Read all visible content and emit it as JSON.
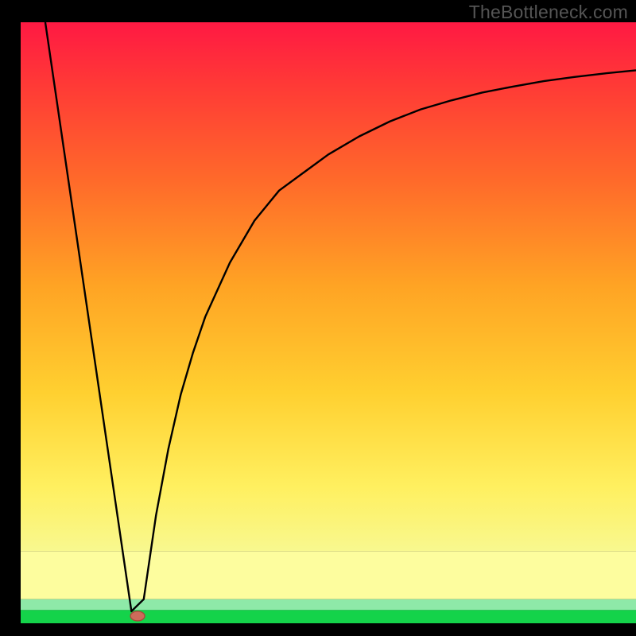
{
  "watermark": "TheBottleneck.com",
  "chart_data": {
    "type": "line",
    "title": "",
    "xlabel": "",
    "ylabel": "",
    "xlim": [
      0,
      100
    ],
    "ylim": [
      0,
      100
    ],
    "curve_description": "V-shaped bottleneck curve: steep linear descent from top-left to a minimum near x≈18, then asymptotic recovery toward top-right.",
    "series": [
      {
        "name": "bottleneck-curve",
        "x": [
          4,
          8,
          12,
          16,
          18,
          20,
          22,
          24,
          26,
          28,
          30,
          34,
          38,
          42,
          46,
          50,
          55,
          60,
          65,
          70,
          75,
          80,
          85,
          90,
          95,
          100
        ],
        "values": [
          100,
          72,
          44,
          16,
          2,
          4,
          18,
          29,
          38,
          45,
          51,
          60,
          67,
          72,
          75,
          78,
          81,
          83.5,
          85.5,
          87,
          88.3,
          89.3,
          90.2,
          90.9,
          91.5,
          92
        ]
      }
    ],
    "marker": {
      "x": 19,
      "y": 1.2
    },
    "bands": [
      {
        "name": "green-strip",
        "y0": 0,
        "y1": 2.2,
        "color": "#14d34a"
      },
      {
        "name": "mint-strip",
        "y0": 2.2,
        "y1": 4.0,
        "color": "#8ee9a8"
      },
      {
        "name": "pale-yellow-strip",
        "y0": 4.0,
        "y1": 12,
        "color": "#fdfd9e"
      }
    ],
    "gradient_stops": [
      {
        "offset": 0,
        "color": "#ff1943"
      },
      {
        "offset": 12,
        "color": "#ff3a36"
      },
      {
        "offset": 30,
        "color": "#ff6a2a"
      },
      {
        "offset": 50,
        "color": "#ffa424"
      },
      {
        "offset": 70,
        "color": "#ffd030"
      },
      {
        "offset": 88,
        "color": "#fff060"
      },
      {
        "offset": 100,
        "color": "#f8f88f"
      }
    ],
    "frame_color": "#000000",
    "curve_color": "#000000",
    "marker_fill": "#cc6b5a",
    "marker_stroke": "#a7493a"
  }
}
